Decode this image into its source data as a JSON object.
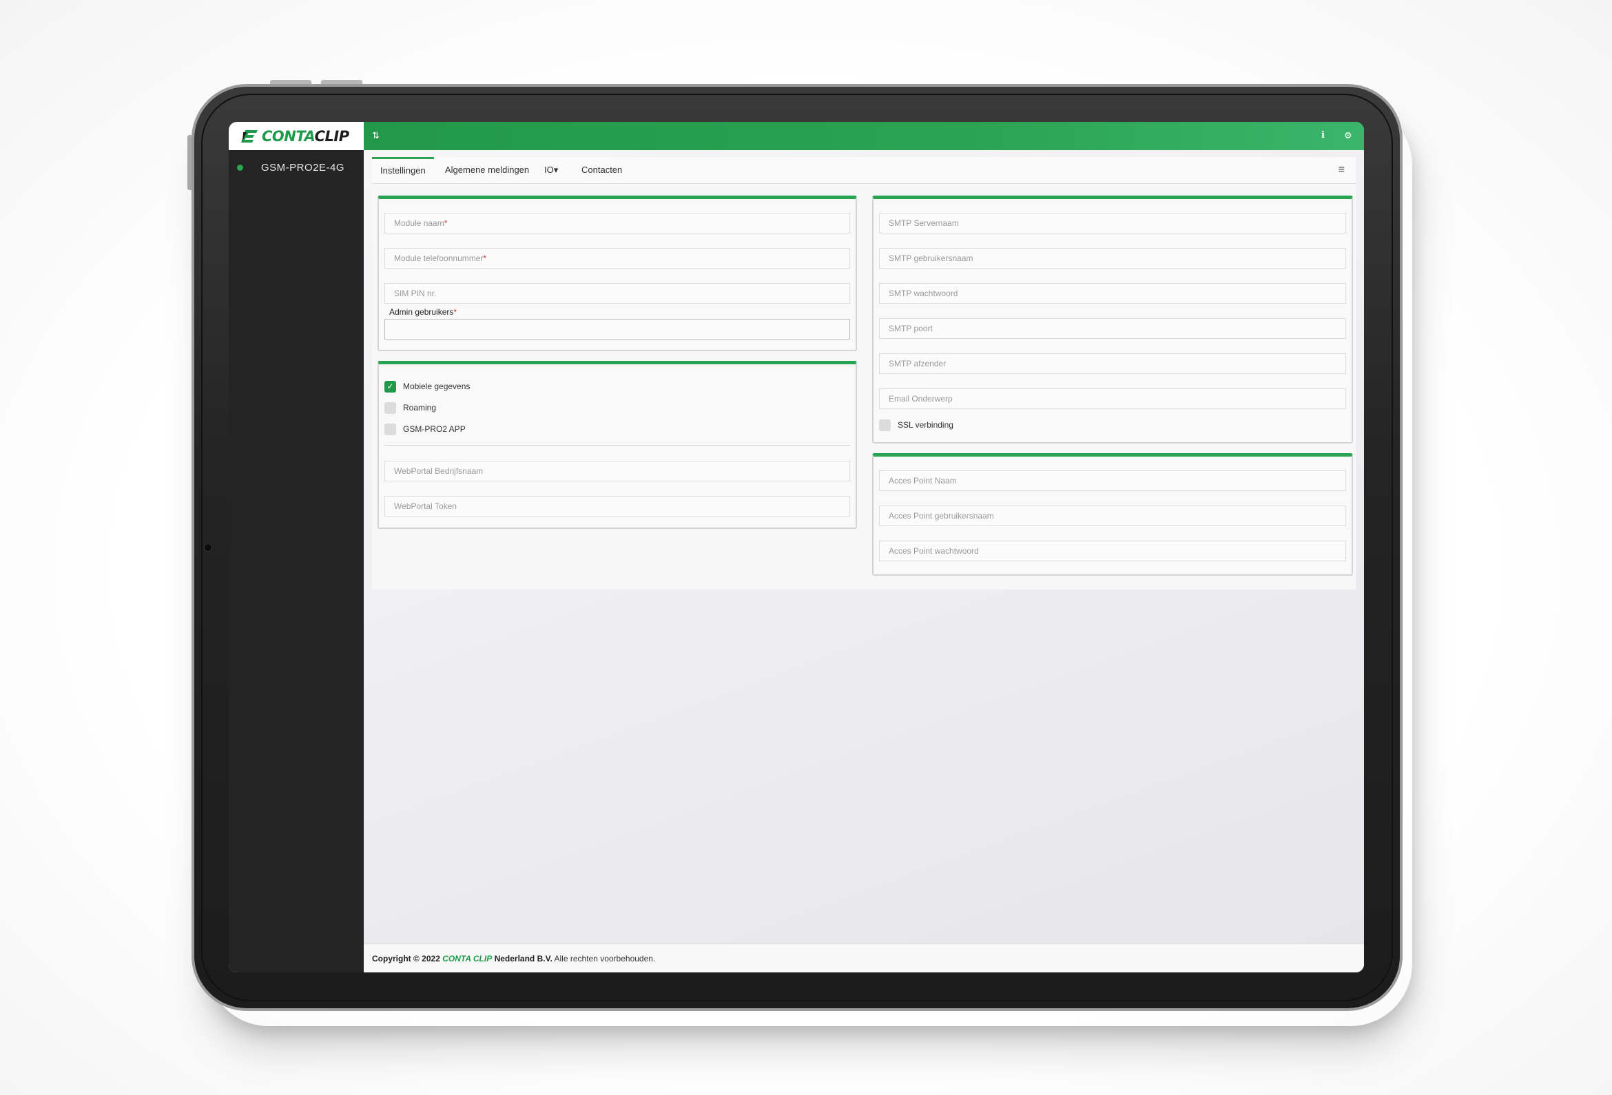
{
  "app": {
    "logo": {
      "part1": "CONTA",
      "part2": "CLIP"
    },
    "device": {
      "name": "GSM-PRO2E-4G",
      "status_color": "#27a84a"
    },
    "accent_color": "#2aa352"
  },
  "topbar": {
    "left_icon": "⇅",
    "info_icon": "i",
    "settings_icon": "⚙"
  },
  "tabs": [
    {
      "label": "Instellingen",
      "active": true
    },
    {
      "label": "Algemene meldingen",
      "active": false
    },
    {
      "label": "IO▾",
      "active": false
    },
    {
      "label": "Contacten",
      "active": false
    }
  ],
  "menu_icon": "≡",
  "module_card": {
    "module_naam": "Module naam",
    "module_telefoonnummer": "Module telefoonnummer",
    "sim_pin": "SIM PIN nr.",
    "admin_label": "Admin gebruikers",
    "required_mark": "*"
  },
  "options_card": {
    "mobiele_gegevens": "Mobiele gegevens",
    "roaming": "Roaming",
    "app": "GSM-PRO2 APP",
    "webportal_bedrijfsnaam": "WebPortal Bedrijfsnaam",
    "webportal_token": "WebPortal Token"
  },
  "smtp_card": {
    "servernaam": "SMTP Servernaam",
    "gebruikersnaam": "SMTP gebruikersnaam",
    "wachtwoord": "SMTP wachtwoord",
    "poort": "SMTP poort",
    "afzender": "SMTP afzender",
    "onderwerp": "Email Onderwerp",
    "ssl": "SSL verbinding"
  },
  "apn_card": {
    "naam": "Acces Point Naam",
    "gebruikersnaam": "Acces Point gebruikersnaam",
    "wachtwoord": "Acces Point wachtwoord"
  },
  "footer": {
    "copyright": "Copyright © 2022",
    "brand": "CONTA CLIP",
    "company": "Nederland B.V.",
    "rights": "Alle rechten voorbehouden."
  }
}
